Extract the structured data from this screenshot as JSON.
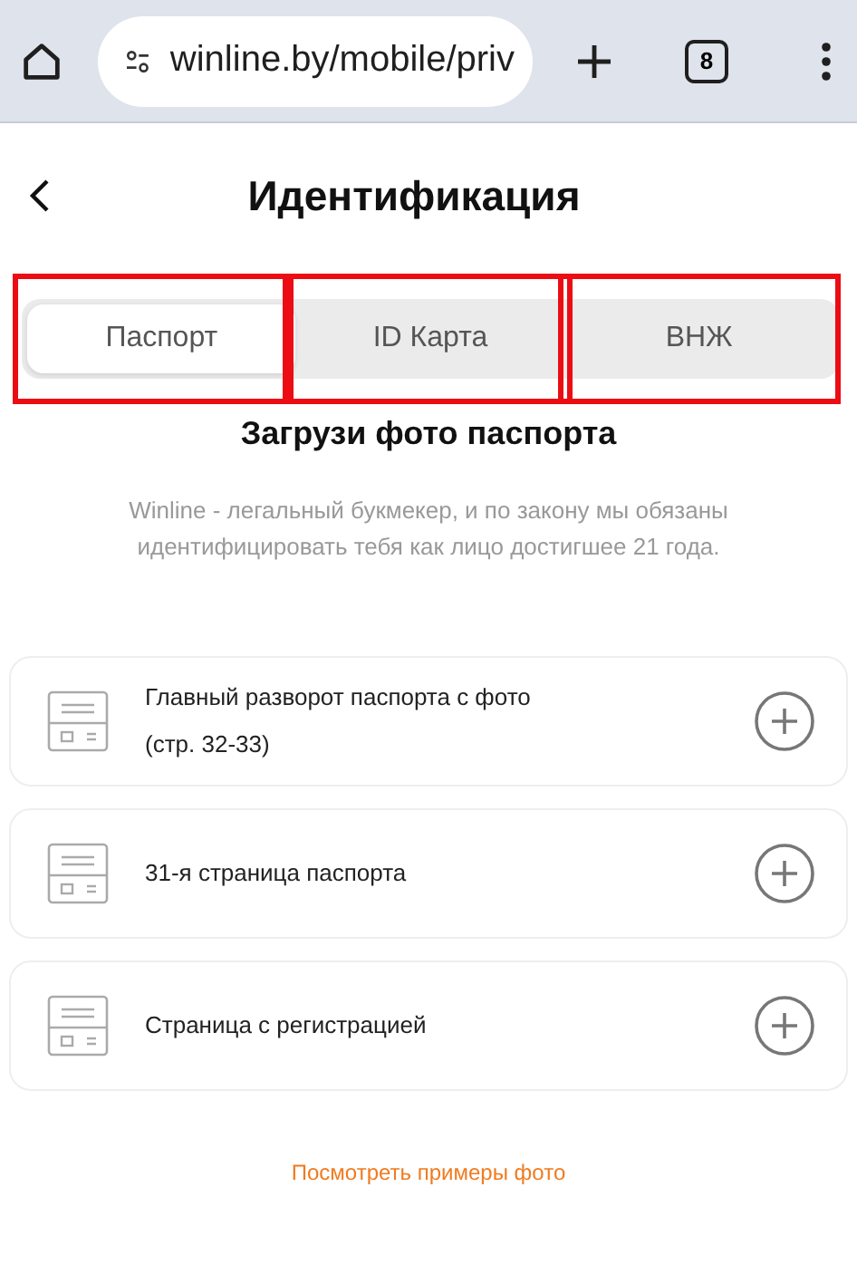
{
  "browser": {
    "url": "winline.by/mobile/priv",
    "tab_count": "8"
  },
  "header": {
    "title": "Идентификация"
  },
  "tabs": [
    {
      "label": "Паспорт",
      "selected": true,
      "highlighted": true
    },
    {
      "label": "ID Карта",
      "selected": false,
      "highlighted": true
    },
    {
      "label": "ВНЖ",
      "selected": false,
      "highlighted": true
    }
  ],
  "heading": "Загрузи фото паспорта",
  "description": "Winline - легальный букмекер, и по закону мы обязаны идентифицировать тебя как лицо достигшее 21 года.",
  "uploads": [
    {
      "label": "Главный разворот паспорта с фото\n(стр. 32-33)"
    },
    {
      "label": "31-я страница паспорта"
    },
    {
      "label": "Страница с регистрацией"
    }
  ],
  "examples_link": "Посмотреть примеры фото"
}
